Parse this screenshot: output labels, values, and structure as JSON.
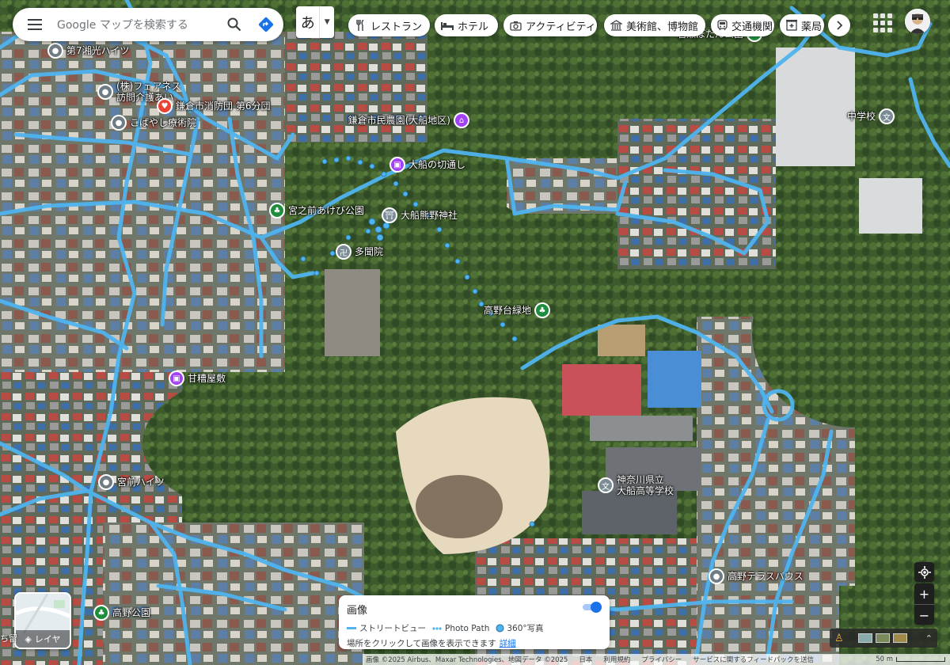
{
  "search": {
    "placeholder": "Google マップを検索する"
  },
  "ime": {
    "key": "あ"
  },
  "categories": [
    {
      "label": "レストラン",
      "icon": "fork-knife-icon"
    },
    {
      "label": "ホテル",
      "icon": "bed-icon"
    },
    {
      "label": "アクティビティ",
      "icon": "camera-icon"
    },
    {
      "label": "美術館、博物館",
      "icon": "museum-icon"
    },
    {
      "label": "交通機関",
      "icon": "train-icon"
    },
    {
      "label": "薬局",
      "icon": "pharmacy-icon"
    }
  ],
  "places": [
    {
      "label": "第7湘光ハイツ",
      "icon": "place-pin-icon"
    },
    {
      "label": "(株)フェアネス\n訪問介護あい",
      "icon": "place-pin-icon"
    },
    {
      "label": "鎌倉市消防団 第6分団",
      "icon": "fire-station-icon"
    },
    {
      "label": "こばやし療術院",
      "icon": "place-pin-icon"
    },
    {
      "label": "鎌倉市民農園(大船地区)",
      "icon": "museum-icon"
    },
    {
      "label": "大船の切通し",
      "icon": "landmark-icon"
    },
    {
      "label": "宮之前あけび公園",
      "icon": "park-icon"
    },
    {
      "label": "大船熊野神社",
      "icon": "shrine-icon"
    },
    {
      "label": "多聞院",
      "icon": "temple-icon"
    },
    {
      "label": "高野台緑地",
      "icon": "park-icon"
    },
    {
      "label": "甘糟屋敷",
      "icon": "landmark-icon"
    },
    {
      "label": "宮前ハイツ",
      "icon": "place-pin-icon"
    },
    {
      "label": "神奈川県立\n大船高等学校",
      "icon": "school-icon"
    },
    {
      "label": "高野テラスハウス",
      "icon": "place-pin-icon"
    },
    {
      "label": "高野公園",
      "icon": "park-icon"
    },
    {
      "label": "岩瀬ぼたん公園",
      "icon": "park-icon"
    },
    {
      "label": "中学校",
      "icon": "school-icon"
    }
  ],
  "panel": {
    "title": "画像",
    "legend_streetview": "ストリートビュー",
    "legend_photopath": "Photo Path",
    "legend_360": "360°写真",
    "hint": "場所をクリックして画像を表示できます",
    "hint_link": "詳細"
  },
  "layers": {
    "label": "レイヤ"
  },
  "footer": {
    "attribution": "画像 ©2025 Airbus、Maxar Technologies、地図データ ©2025",
    "links": [
      "日本",
      "利用規約",
      "プライバシー",
      "サービスに関するフィードバックを送信"
    ],
    "scale": "50 m"
  },
  "left_edge_labels": [
    "ち留"
  ],
  "colors": {
    "street_view": "#4fb4ee",
    "accent": "#1a73e8",
    "park": "#1e8e3e",
    "landmark": "#a142f4",
    "fire": "#ea4335"
  }
}
